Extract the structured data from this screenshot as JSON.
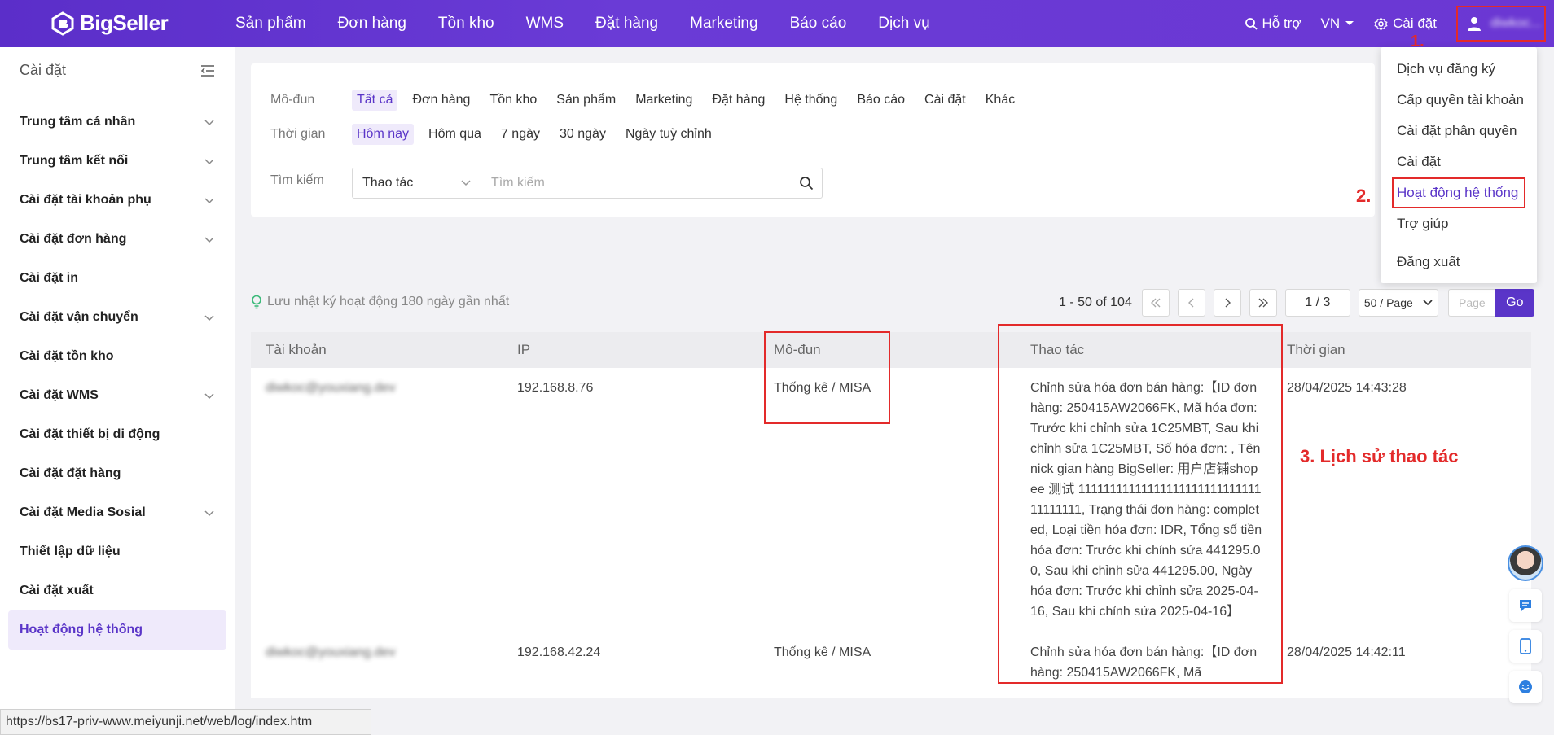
{
  "brand": {
    "name": "BigSeller"
  },
  "nav": [
    "Sản phẩm",
    "Đơn hàng",
    "Tồn kho",
    "WMS",
    "Đặt hàng",
    "Marketing",
    "Báo cáo",
    "Dịch vụ"
  ],
  "top_right": {
    "help": "Hỗ trợ",
    "lang": "VN",
    "settings": "Cài đặt",
    "user": "diwkoc..."
  },
  "sidebar": {
    "title": "Cài đặt",
    "items": [
      {
        "label": "Trung tâm cá nhân",
        "expandable": true
      },
      {
        "label": "Trung tâm kết nối",
        "expandable": true
      },
      {
        "label": "Cài đặt tài khoản phụ",
        "expandable": true
      },
      {
        "label": "Cài đặt đơn hàng",
        "expandable": true
      },
      {
        "label": "Cài đặt in",
        "expandable": false
      },
      {
        "label": "Cài đặt vận chuyển",
        "expandable": true
      },
      {
        "label": "Cài đặt tồn kho",
        "expandable": false
      },
      {
        "label": "Cài đặt WMS",
        "expandable": true
      },
      {
        "label": "Cài đặt thiết bị di động",
        "expandable": false
      },
      {
        "label": "Cài đặt đặt hàng",
        "expandable": false
      },
      {
        "label": "Cài đặt Media Sosial",
        "expandable": true
      },
      {
        "label": "Thiết lập dữ liệu",
        "expandable": false
      },
      {
        "label": "Cài đặt xuất",
        "expandable": false
      },
      {
        "label": "Hoạt động hệ thống",
        "expandable": false,
        "active": true
      }
    ]
  },
  "filters": {
    "module_label": "Mô-đun",
    "modules": [
      "Tất cả",
      "Đơn hàng",
      "Tồn kho",
      "Sản phẩm",
      "Marketing",
      "Đặt hàng",
      "Hệ thống",
      "Báo cáo",
      "Cài đặt",
      "Khác"
    ],
    "module_selected": 0,
    "time_label": "Thời gian",
    "times": [
      "Hôm nay",
      "Hôm qua",
      "7 ngày",
      "30 ngày",
      "Ngày tuỳ chỉnh"
    ],
    "time_selected": 0,
    "search_label": "Tìm kiếm",
    "search_type": "Thao tác",
    "search_placeholder": "Tìm kiếm"
  },
  "tip": "Lưu nhật ký hoạt động 180 ngày gần nhất",
  "pager": {
    "info": "1 - 50 of 104",
    "current": "1 / 3",
    "size": "50 / Page",
    "page_placeholder": "Page",
    "go": "Go"
  },
  "table": {
    "columns": [
      "Tài khoản",
      "IP",
      "Mô-đun",
      "Thao tác",
      "Thời gian"
    ],
    "rows": [
      {
        "account": "diwkoc@youxiang.dev",
        "ip": "192.168.8.76",
        "module": "Thống kê / MISA",
        "operation": "Chỉnh sửa hóa đơn bán hàng:【ID đơn hàng: 250415AW2066FK, Mã hóa đơn: Trước khi chỉnh sửa 1C25MBT, Sau khi chỉnh sửa 1C25MBT, Số hóa đơn: , Tên nick gian hàng BigSeller: 用户店铺shopee 测试 1111111111111111111111111111111111111, Trạng thái đơn hàng: completed, Loại tiền hóa đơn: IDR, Tổng số tiền hóa đơn: Trước khi chỉnh sửa 441295.00, Sau khi chỉnh sửa 441295.00, Ngày hóa đơn: Trước khi chỉnh sửa 2025-04-16, Sau khi chỉnh sửa 2025-04-16】",
        "time": "28/04/2025 14:43:28"
      },
      {
        "account": "diwkoc@youxiang.dev",
        "ip": "192.168.42.24",
        "module": "Thống kê / MISA",
        "operation": "Chỉnh sửa hóa đơn bán hàng:【ID đơn hàng: 250415AW2066FK, Mã",
        "time": "28/04/2025 14:42:11"
      }
    ]
  },
  "dropdown": [
    "Dịch vụ đăng ký",
    "Cấp quyền tài khoản",
    "Cài đặt phân quyền",
    "Cài đặt",
    "Hoạt động hệ thống",
    "Trợ giúp",
    "Đăng xuất"
  ],
  "annotations": {
    "a1": "1.",
    "a2": "2.",
    "a3": "3. Lịch sử thao tác"
  },
  "status_url": "https://bs17-priv-www.meiyunji.net/web/log/index.htm",
  "colors": {
    "primary": "#5a35c8",
    "annotation": "#e32a2a"
  }
}
